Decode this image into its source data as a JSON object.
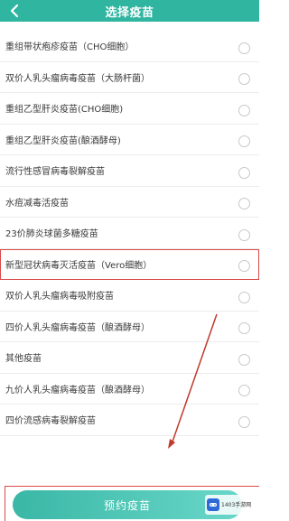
{
  "header": {
    "title": "选择疫苗",
    "background": "#2fb5a0"
  },
  "vaccines": [
    {
      "label": "重组带状疱疹疫苗（CHO细胞）",
      "selected": false,
      "highlighted": false
    },
    {
      "label": "双价人乳头瘤病毒疫苗（大肠杆菌）",
      "selected": false,
      "highlighted": false
    },
    {
      "label": "重组乙型肝炎疫苗(CHO细胞)",
      "selected": false,
      "highlighted": false
    },
    {
      "label": "重组乙型肝炎疫苗(酿酒酵母)",
      "selected": false,
      "highlighted": false
    },
    {
      "label": "流行性感冒病毒裂解疫苗",
      "selected": false,
      "highlighted": false
    },
    {
      "label": "水痘减毒活疫苗",
      "selected": false,
      "highlighted": false
    },
    {
      "label": "23价肺炎球菌多糖疫苗",
      "selected": false,
      "highlighted": false
    },
    {
      "label": "新型冠状病毒灭活疫苗（Vero细胞）",
      "selected": false,
      "highlighted": true
    },
    {
      "label": "双价人乳头瘤病毒吸附疫苗",
      "selected": false,
      "highlighted": false
    },
    {
      "label": "四价人乳头瘤病毒疫苗（酿酒酵母）",
      "selected": false,
      "highlighted": false
    },
    {
      "label": "其他疫苗",
      "selected": false,
      "highlighted": false
    },
    {
      "label": "九价人乳头瘤病毒疫苗（酿酒酵母）",
      "selected": false,
      "highlighted": false
    },
    {
      "label": "四价流感病毒裂解疫苗",
      "selected": false,
      "highlighted": false
    }
  ],
  "reserve_button": {
    "label": "预约疫苗"
  },
  "watermark": {
    "text": "1403手游网"
  },
  "colors": {
    "highlight": "#d94a4a",
    "accent": "#3ab7a6"
  }
}
